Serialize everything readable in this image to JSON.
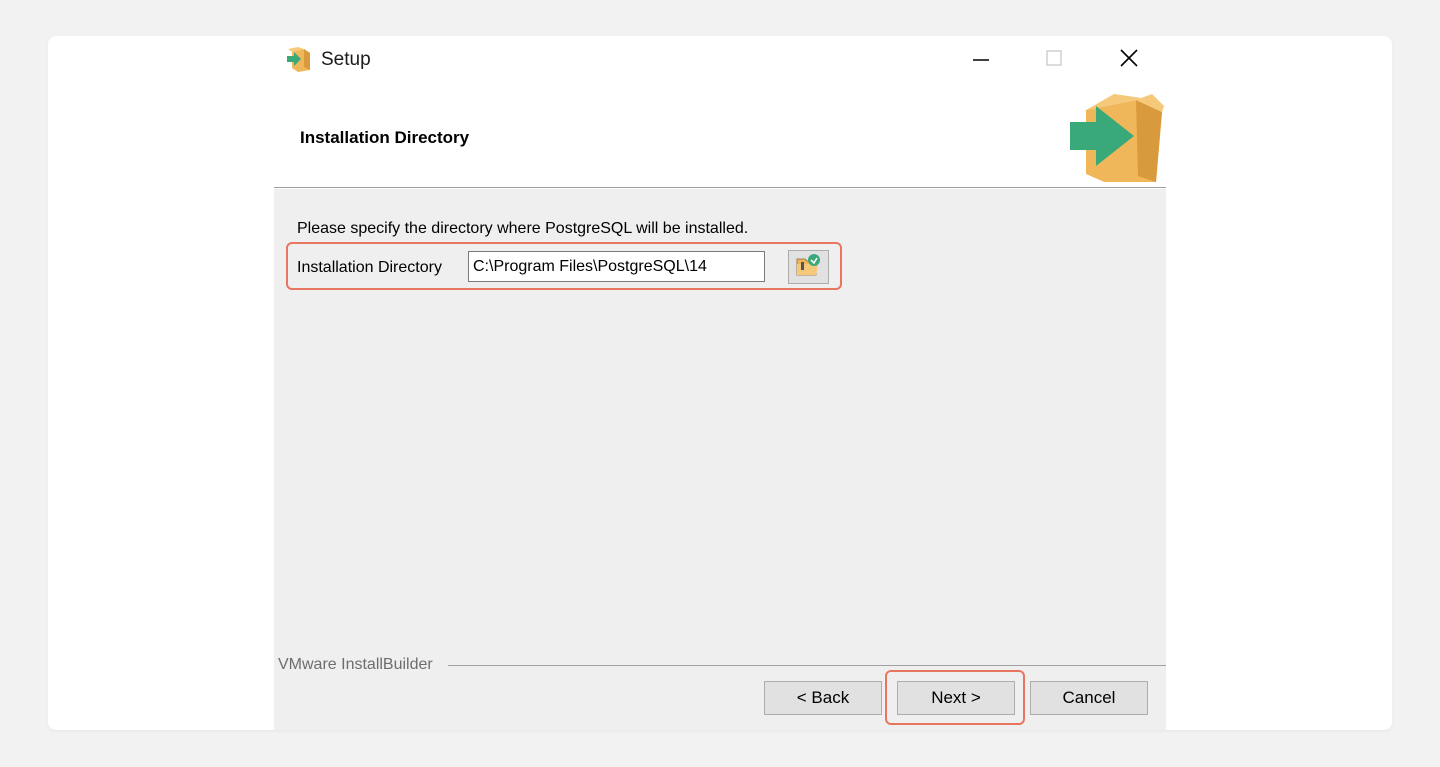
{
  "window": {
    "title": "Setup",
    "app_icon": "installer-box-icon",
    "controls": {
      "minimize_icon": "minimize-icon",
      "maximize_icon": "maximize-icon",
      "close_icon": "close-icon"
    }
  },
  "header": {
    "title": "Installation Directory",
    "logo_icon": "installer-box-icon"
  },
  "content": {
    "instruction": "Please specify the directory where PostgreSQL will be installed.",
    "directory": {
      "label": "Installation Directory",
      "value": "C:\\Program Files\\PostgreSQL\\14",
      "browse_icon": "folder-browse-icon"
    }
  },
  "footer": {
    "brand": "VMware InstallBuilder",
    "back_label": "< Back",
    "next_label": "Next >",
    "cancel_label": "Cancel"
  },
  "colors": {
    "highlight": "#e8765e",
    "panel_background": "#efefef",
    "box_orange": "#f0b65a",
    "arrow_green": "#3aa97a"
  }
}
